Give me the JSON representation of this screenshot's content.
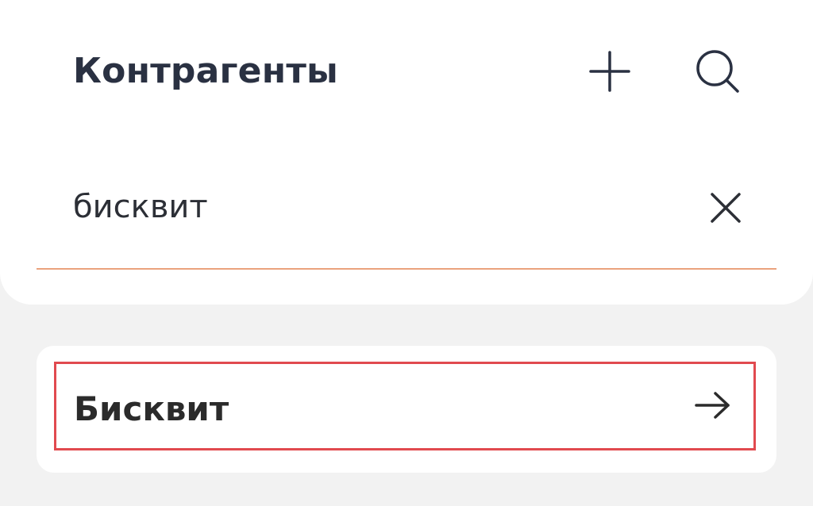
{
  "header": {
    "title": "Контрагенты",
    "icons": {
      "add": "plus-icon",
      "search": "search-icon"
    }
  },
  "search": {
    "value": "бисквит",
    "clear_icon": "close-icon",
    "underline_color": "#eaa27d"
  },
  "results": {
    "items": [
      {
        "label": "Бисквит",
        "icon": "arrow-right-icon"
      }
    ]
  },
  "colors": {
    "background": "#f2f2f2",
    "panel": "#ffffff",
    "title": "#2a3142",
    "highlight_border": "#e14a4f"
  }
}
